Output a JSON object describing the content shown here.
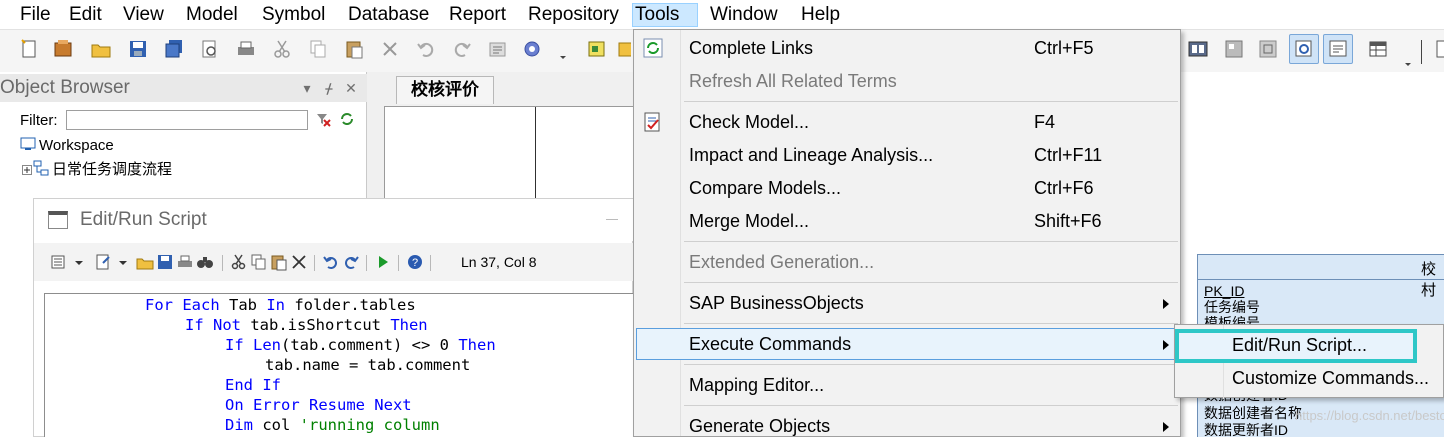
{
  "menubar": {
    "items": [
      {
        "label": "File"
      },
      {
        "label": "Edit"
      },
      {
        "label": "View"
      },
      {
        "label": "Model"
      },
      {
        "label": "Symbol"
      },
      {
        "label": "Database"
      },
      {
        "label": "Report"
      },
      {
        "label": "Repository"
      },
      {
        "label": "Tools"
      },
      {
        "label": "Window"
      },
      {
        "label": "Help"
      }
    ],
    "active": "Tools"
  },
  "object_browser": {
    "title": "Object Browser",
    "filter_label": "Filter:",
    "filter_value": "",
    "tree": [
      {
        "label": "Workspace",
        "icon": "workspace-icon"
      },
      {
        "label": "日常任务调度流程",
        "icon": "model-icon"
      }
    ]
  },
  "diagram_tab": {
    "label": "校核评价"
  },
  "script_dialog": {
    "title": "Edit/Run Script",
    "cursor_position": "Ln 37, Col 8",
    "code_lines": [
      {
        "indent": 2,
        "parts": [
          {
            "t": "For Each",
            "k": "kw"
          },
          {
            "t": " Tab ",
            "k": ""
          },
          {
            "t": "In",
            "k": "kw"
          },
          {
            "t": " folder.tables",
            "k": ""
          }
        ]
      },
      {
        "indent": 3,
        "parts": [
          {
            "t": "If Not",
            "k": "kw"
          },
          {
            "t": " tab.isShortcut ",
            "k": ""
          },
          {
            "t": "Then",
            "k": "kw"
          }
        ]
      },
      {
        "indent": 4,
        "parts": [
          {
            "t": "If",
            "k": "kw"
          },
          {
            "t": " ",
            "k": ""
          },
          {
            "t": "Len",
            "k": "kw"
          },
          {
            "t": "(tab.comment) <> 0 ",
            "k": ""
          },
          {
            "t": "Then",
            "k": "kw"
          }
        ]
      },
      {
        "indent": 5,
        "parts": [
          {
            "t": "tab.name = tab.comment",
            "k": ""
          }
        ]
      },
      {
        "indent": 4,
        "parts": [
          {
            "t": "End If",
            "k": "kw"
          }
        ]
      },
      {
        "indent": 4,
        "parts": [
          {
            "t": "On Error Resume Next",
            "k": "kw"
          }
        ]
      },
      {
        "indent": 4,
        "parts": [
          {
            "t": "Dim",
            "k": "kw"
          },
          {
            "t": " col ",
            "k": ""
          },
          {
            "t": "'running column",
            "k": "cm"
          }
        ]
      }
    ]
  },
  "tools_menu": {
    "items": [
      {
        "label": "Complete Links",
        "shortcut": "Ctrl+F5",
        "icon": "refresh-links-icon"
      },
      {
        "label": "Refresh All Related Terms",
        "shortcut": "",
        "disabled": true
      },
      {
        "label": "Check Model...",
        "shortcut": "F4",
        "icon": "check-model-icon"
      },
      {
        "label": "Impact and Lineage Analysis...",
        "shortcut": "Ctrl+F11"
      },
      {
        "label": "Compare Models...",
        "shortcut": "Ctrl+F6"
      },
      {
        "label": "Merge Model...",
        "shortcut": "Shift+F6"
      },
      {
        "label": "Extended Generation...",
        "shortcut": "",
        "disabled": true
      },
      {
        "label": "SAP BusinessObjects",
        "shortcut": "",
        "submenu": true
      },
      {
        "label": "Execute Commands",
        "shortcut": "",
        "submenu": true,
        "highlighted": true
      },
      {
        "label": "Mapping Editor...",
        "shortcut": ""
      },
      {
        "label": "Generate Objects",
        "shortcut": "",
        "submenu": true
      }
    ]
  },
  "execute_commands_submenu": {
    "items": [
      {
        "label": "Edit/Run Script...",
        "highlighted": true
      },
      {
        "label": "Customize Commands..."
      }
    ]
  },
  "entity": {
    "header": "校村",
    "rows": [
      "PK_ID",
      "任务编号",
      "模板编号",
      "数据创建者ID",
      "数据创建者名称",
      "数据更新者ID"
    ]
  },
  "watermark": "https://blog.csdn.net/besto229",
  "colors": {
    "menu_highlight_border": "#5a9ede",
    "submenu_callout": "#2ec7c7",
    "keyword": "#0000ff",
    "comment": "#008000",
    "entity_fill": "#d9e8f7"
  }
}
